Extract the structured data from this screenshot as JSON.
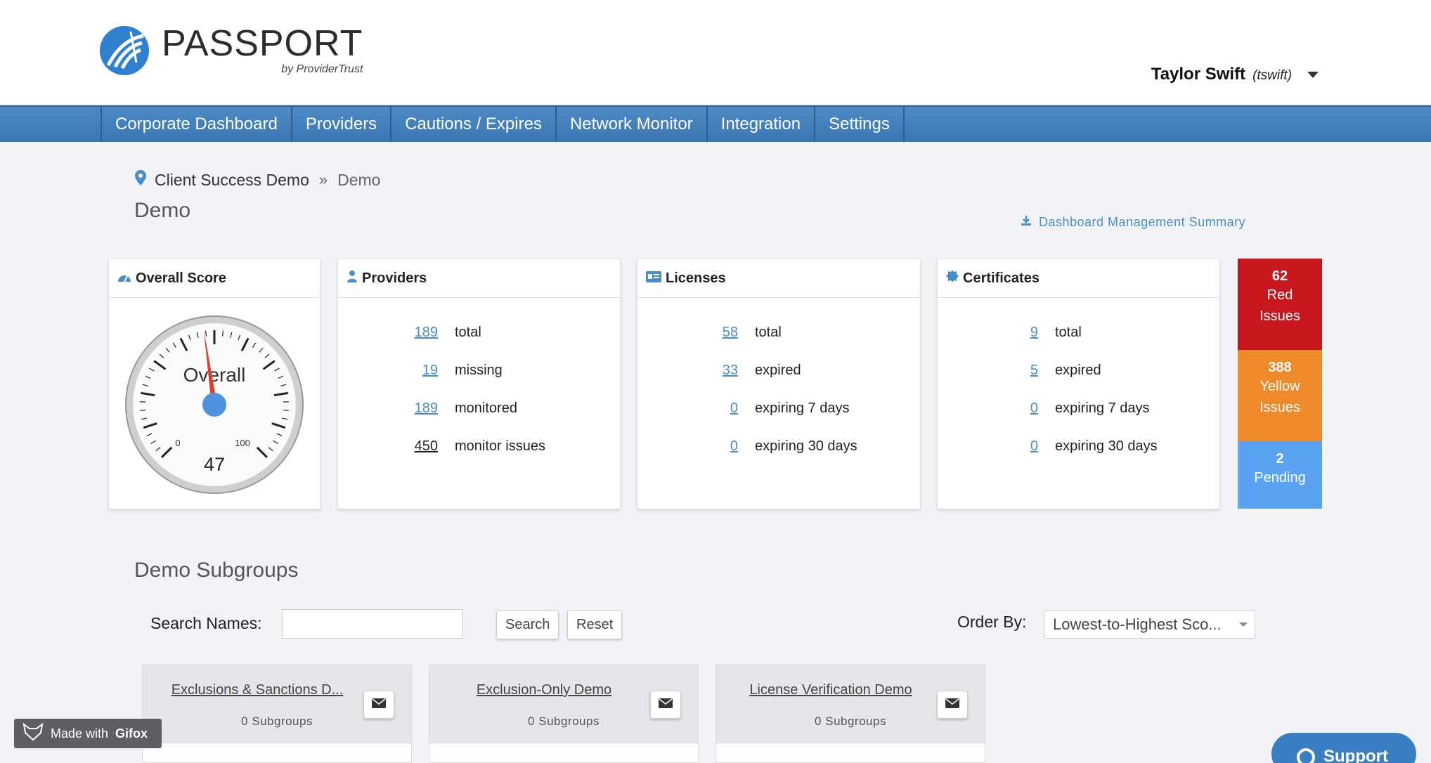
{
  "header": {
    "logo_title": "PASSPORT",
    "logo_sub": "by ProviderTrust",
    "user_name": "Taylor Swift",
    "user_handle": "(tswift)"
  },
  "nav": {
    "items": [
      {
        "label": "Corporate Dashboard"
      },
      {
        "label": "Providers"
      },
      {
        "label": "Cautions / Expires"
      },
      {
        "label": "Network Monitor"
      },
      {
        "label": "Integration"
      },
      {
        "label": "Settings"
      }
    ]
  },
  "breadcrumb": {
    "parent": "Client Success Demo",
    "current": "Demo"
  },
  "page": {
    "title": "Demo",
    "mgmt_link": "Dashboard Management Summary"
  },
  "overall": {
    "title": "Overall Score",
    "gauge_label": "Overall",
    "min": "0",
    "max": "100",
    "value": 47,
    "value_text": "47"
  },
  "providers": {
    "title": "Providers",
    "rows": [
      {
        "num": "189",
        "label": "total"
      },
      {
        "num": "19",
        "label": "missing"
      },
      {
        "num": "189",
        "label": "monitored"
      },
      {
        "num": "450",
        "label": "monitor issues"
      }
    ]
  },
  "licenses": {
    "title": "Licenses",
    "rows": [
      {
        "num": "58",
        "label": "total"
      },
      {
        "num": "33",
        "label": "expired"
      },
      {
        "num": "0",
        "label": "expiring 7 days"
      },
      {
        "num": "0",
        "label": "expiring 30 days"
      }
    ]
  },
  "certificates": {
    "title": "Certificates",
    "rows": [
      {
        "num": "9",
        "label": "total"
      },
      {
        "num": "5",
        "label": "expired"
      },
      {
        "num": "0",
        "label": "expiring 7 days"
      },
      {
        "num": "0",
        "label": "expiring 30 days"
      }
    ]
  },
  "issues": {
    "red": {
      "num": "62",
      "label1": "Red",
      "label2": "Issues"
    },
    "yellow": {
      "num": "388",
      "label1": "Yellow",
      "label2": "Issues"
    },
    "pending": {
      "num": "2",
      "label1": "Pending"
    }
  },
  "subgroups": {
    "title": "Demo Subgroups",
    "search_label": "Search Names:",
    "search_placeholder": "",
    "search_button": "Search",
    "reset_button": "Reset",
    "order_label": "Order By:",
    "order_value": "Lowest-to-Highest Sco...",
    "cards": [
      {
        "name": "Exclusions & Sanctions D...",
        "count": "0  Subgroups"
      },
      {
        "name": "Exclusion-Only Demo",
        "count": "0  Subgroups"
      },
      {
        "name": "License Verification Demo",
        "count": "0  Subgroups"
      }
    ]
  },
  "overlay": {
    "gifox_prefix": "Made with",
    "gifox_brand": "Gifox",
    "support": "Support"
  },
  "colors": {
    "nav": "#3a76b2",
    "link": "#4a8ec8",
    "red": "#c8161e",
    "yellow": "#ee8a2a",
    "blue": "#5ba3f2"
  }
}
